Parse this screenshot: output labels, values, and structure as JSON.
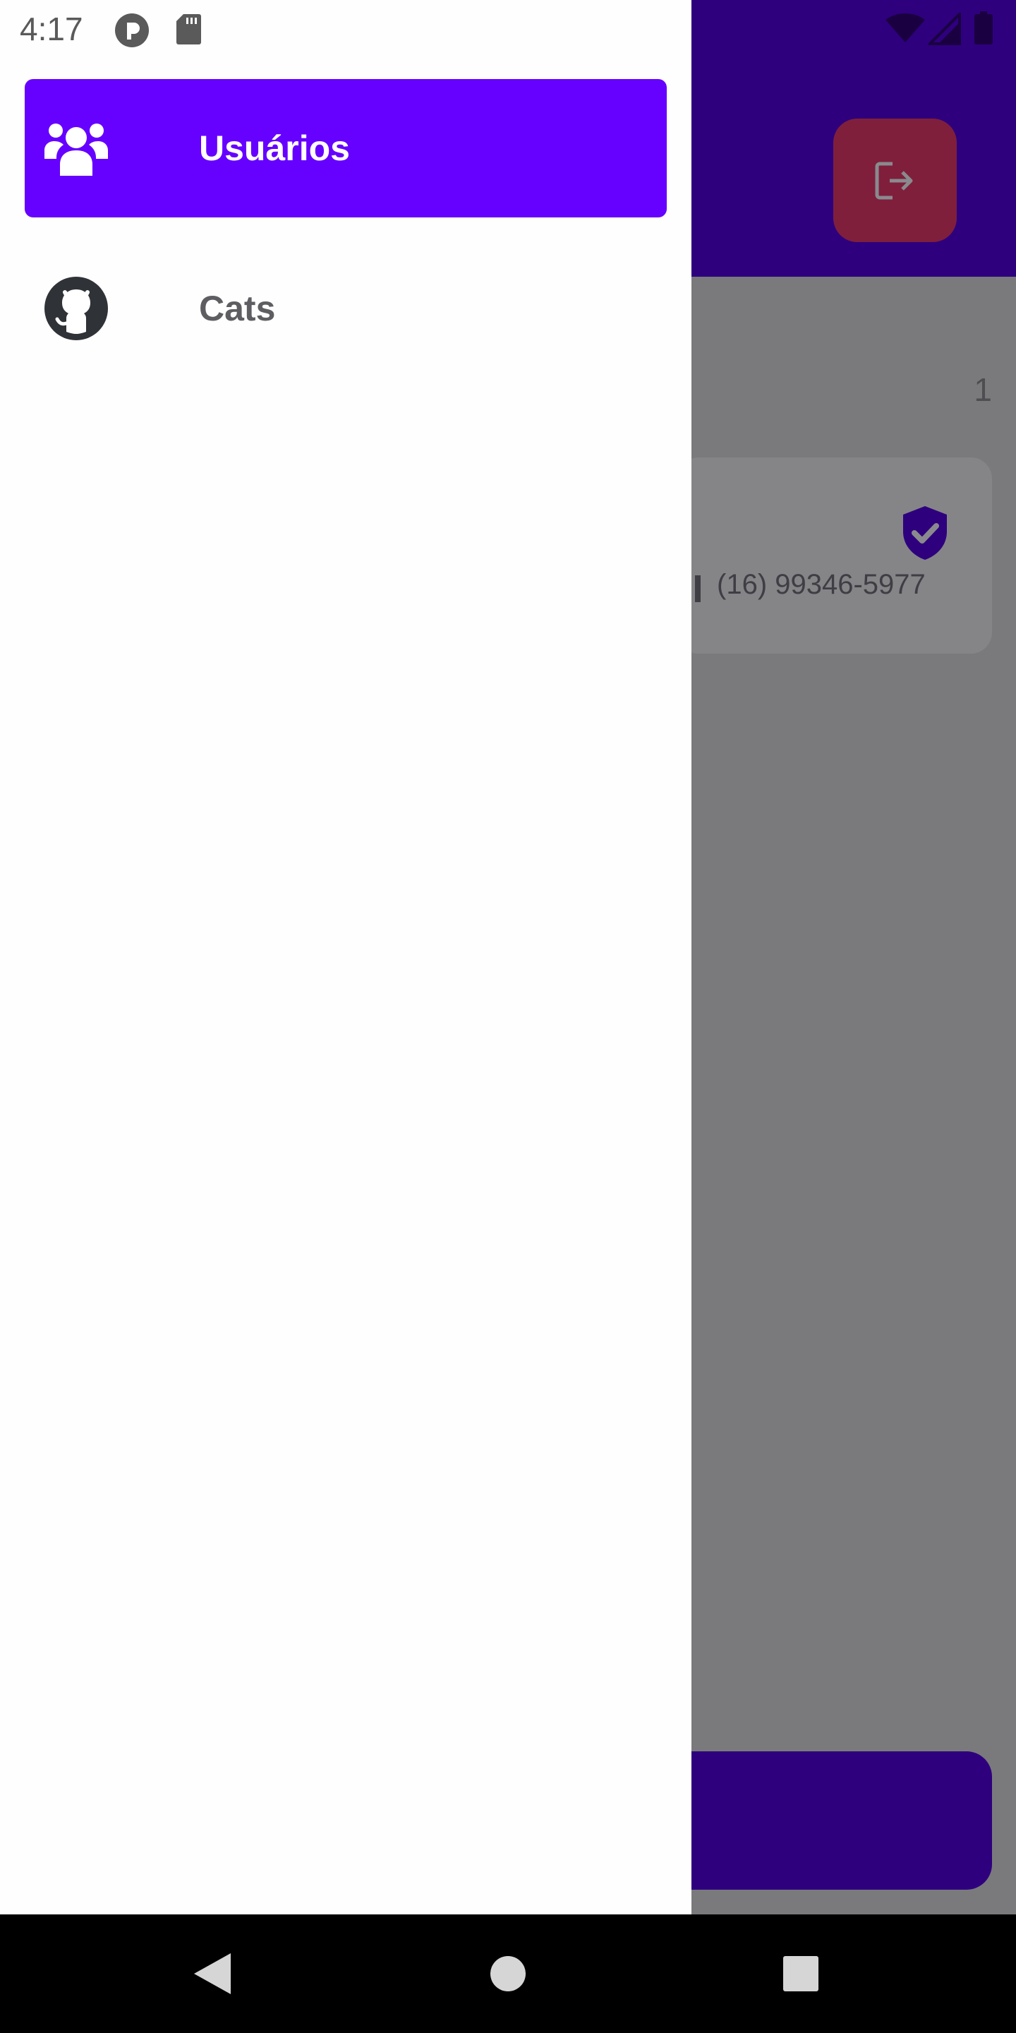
{
  "status_bar": {
    "time": "4:17",
    "icons": [
      "app-indicator-icon",
      "sd-card-icon",
      "wifi-icon",
      "signal-icon",
      "battery-icon"
    ]
  },
  "drawer": {
    "items": [
      {
        "label": "Usuários",
        "icon": "users-icon",
        "active": true
      },
      {
        "label": "Cats",
        "icon": "github-icon",
        "active": false
      }
    ]
  },
  "background_screen": {
    "header_icon": "logout-icon",
    "count": "1",
    "card": {
      "phone": "(16) 99346-5977",
      "badge_icon": "verified-shield-icon"
    }
  },
  "nav_bar": {
    "buttons": [
      "back-icon",
      "home-icon",
      "recents-icon"
    ]
  },
  "colors": {
    "accent": "#6600ff",
    "header_dimmed": "#2e007e",
    "logout_dimmed": "#7f1f3c",
    "scrim_background": "#7a7a7c",
    "drawer_background": "#fefefe"
  }
}
